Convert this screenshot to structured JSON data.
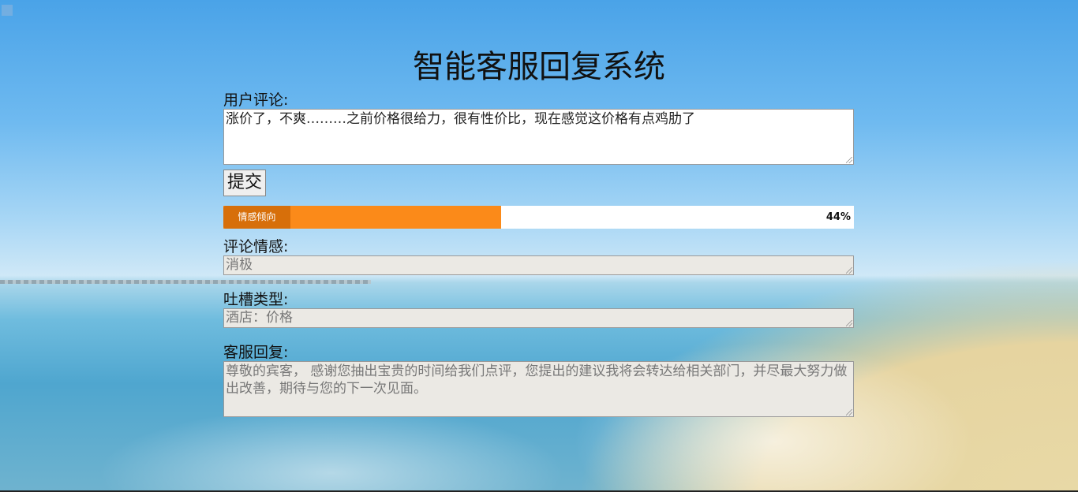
{
  "header": {
    "title": "智能客服回复系统"
  },
  "form": {
    "comment_label": "用户评论:",
    "comment_value": "涨价了，不爽………之前价格很给力，很有性价比，现在感觉这价格有点鸡肋了",
    "submit_label": "提交",
    "sentiment_progress": {
      "tag": "情感倾向",
      "percent_text": "44%",
      "fraction": 0.44
    },
    "sentiment_label": "评论情感:",
    "sentiment_value": "消极",
    "complaint_label": "吐槽类型:",
    "complaint_value": "酒店：价格",
    "reply_label": "客服回复:",
    "reply_value": "尊敬的宾客， 感谢您抽出宝贵的时间给我们点评，您提出的建议我将会转达给相关部门，并尽最大努力做出改善，期待与您的下一次见面。"
  },
  "colors": {
    "progress_fill": "#fb8a19",
    "progress_tag": "#d76f0a"
  }
}
